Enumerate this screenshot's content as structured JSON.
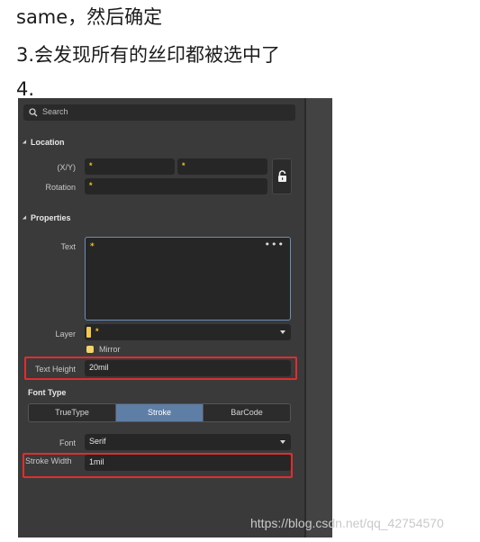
{
  "document": {
    "line1": "same，然后确定",
    "line2": "3.会发现所有的丝印都被选中了",
    "line3": "4."
  },
  "panel": {
    "search": {
      "placeholder": "Search",
      "icon": "search-icon"
    },
    "location": {
      "title": "Location",
      "xy_label": "(X/Y)",
      "x_value": "*",
      "y_value": "*",
      "rotation_label": "Rotation",
      "rotation_value": "*",
      "lock_icon": "lock-icon"
    },
    "properties": {
      "title": "Properties",
      "text_label": "Text",
      "text_value": "*",
      "text_more": "•••",
      "layer_label": "Layer",
      "layer_value": "*",
      "mirror_label": "Mirror",
      "mirror_checked": true,
      "text_height_label": "Text Height",
      "text_height_value": "20mil"
    },
    "font_type": {
      "title": "Font Type",
      "options": [
        "TrueType",
        "Stroke",
        "BarCode"
      ],
      "selected": "Stroke",
      "font_label": "Font",
      "font_value": "Serif",
      "stroke_width_label": "Stroke Width",
      "stroke_width_value": "1mil"
    }
  },
  "watermark": "https://blog.csdn.net/qq_42754570",
  "colors": {
    "panel_bg": "#3a3a3a",
    "field_bg": "#262626",
    "accent_blue": "#5e7ea6",
    "highlight_red": "#e12d2d",
    "wildcard_yellow": "#f0c419"
  }
}
